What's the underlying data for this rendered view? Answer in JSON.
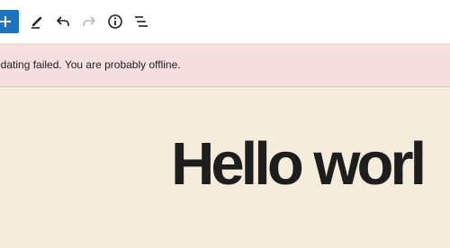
{
  "toolbar": {
    "items": [
      {
        "icon": "plus-icon",
        "label": "Add block"
      },
      {
        "icon": "pencil-icon",
        "label": "Tools"
      },
      {
        "icon": "undo-icon",
        "label": "Undo"
      },
      {
        "icon": "redo-icon",
        "label": "Redo"
      },
      {
        "icon": "info-icon",
        "label": "Details"
      },
      {
        "icon": "list-view-icon",
        "label": "List View"
      }
    ],
    "accent_color": "#1e73be"
  },
  "notice": {
    "text": "pdating failed. You are probably offline.",
    "background": "#f7dfe0"
  },
  "post": {
    "title": "Hello worl"
  },
  "canvas": {
    "background": "#f5eddb"
  }
}
